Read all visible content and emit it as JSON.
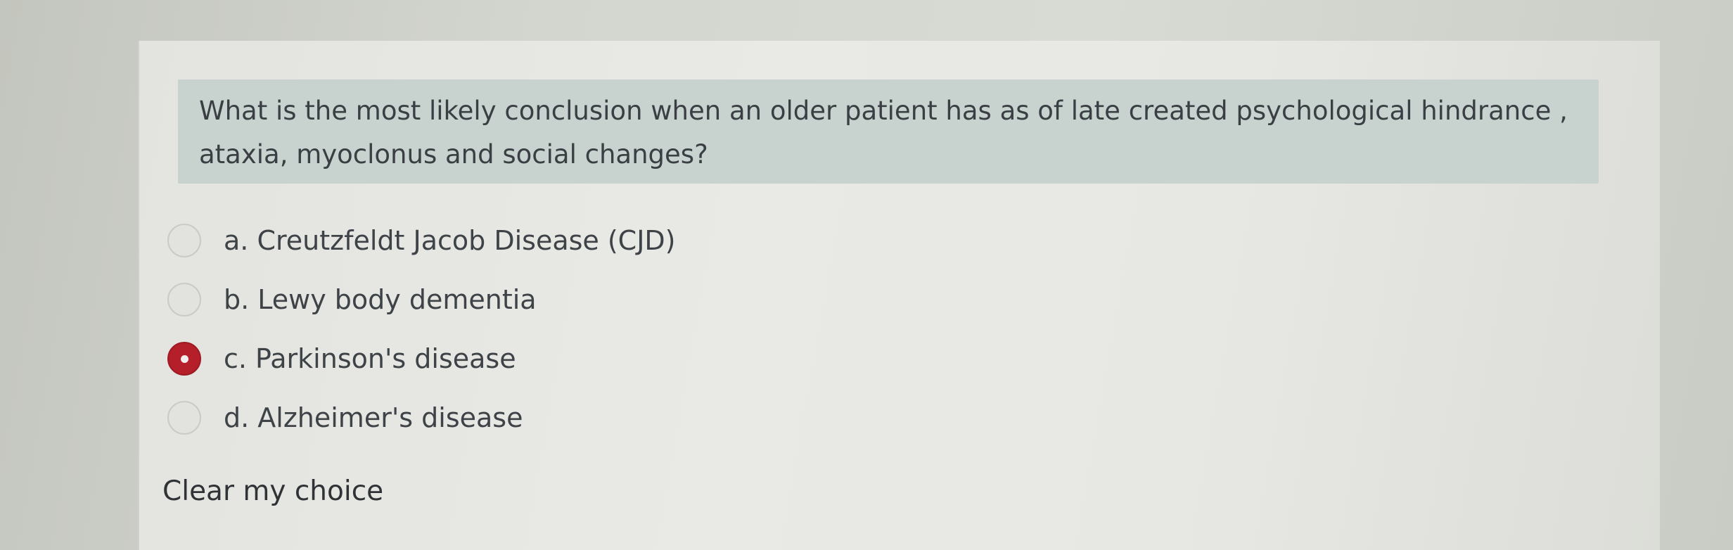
{
  "question": {
    "text": "What is the most likely conclusion when an older patient has as of late created psychological hindrance , ataxia, myoclonus and social changes?"
  },
  "answers": [
    {
      "label": "a. Creutzfeldt Jacob Disease (CJD)",
      "selected": false
    },
    {
      "label": "b. Lewy body dementia",
      "selected": false
    },
    {
      "label": "c. Parkinson's disease",
      "selected": true
    },
    {
      "label": "d. Alzheimer's disease",
      "selected": false
    }
  ],
  "actions": {
    "clear_choice_label": "Clear my choice"
  },
  "colors": {
    "selected_radio": "#b41f2a",
    "question_background": "#c8d2ce"
  }
}
